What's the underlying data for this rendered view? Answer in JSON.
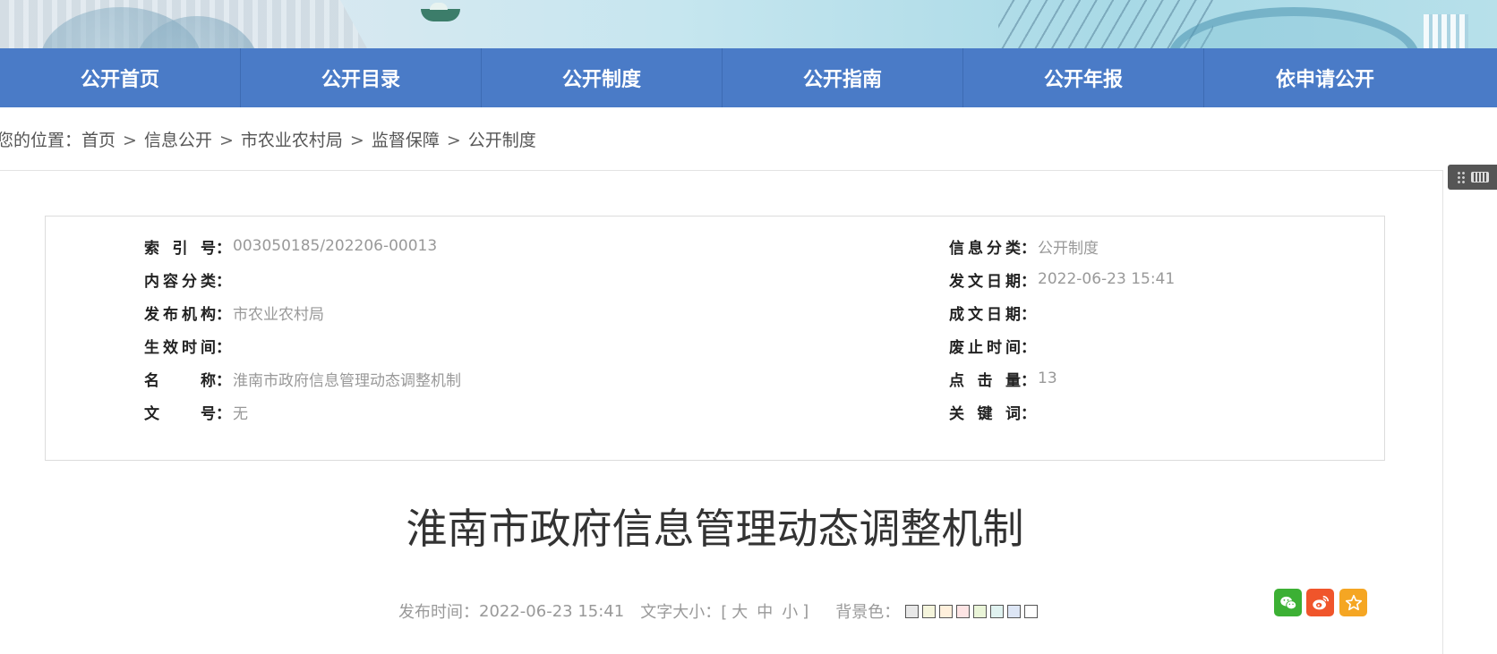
{
  "nav": {
    "items": [
      {
        "label": "公开首页"
      },
      {
        "label": "公开目录"
      },
      {
        "label": "公开制度"
      },
      {
        "label": "公开指南"
      },
      {
        "label": "公开年报"
      },
      {
        "label": "依申请公开"
      }
    ]
  },
  "breadcrumb": {
    "prefix": "您的位置：",
    "items": [
      "首页",
      "信息公开",
      "市农业农村局",
      "监督保障",
      "公开制度"
    ],
    "separator": ">"
  },
  "meta": {
    "index_label": "索引号",
    "index_value": "003050185/202206-00013",
    "category_label": "信息分类",
    "category_value": "公开制度",
    "content_class_label": "内容分类",
    "content_class_value": "",
    "issue_date_label": "发文日期",
    "issue_date_value": "2022-06-23 15:41",
    "publisher_label": "发布机构",
    "publisher_value": "市农业农村局",
    "written_date_label": "成文日期",
    "written_date_value": "",
    "effective_label": "生效时间",
    "effective_value": "",
    "abolish_label": "废止时间",
    "abolish_value": "",
    "name_label": "名称",
    "name_value": "淮南市政府信息管理动态调整机制",
    "clicks_label": "点击量",
    "clicks_value": "13",
    "doc_no_label": "文号",
    "doc_no_value": "无",
    "keywords_label": "关键词",
    "keywords_value": "",
    "colon": "："
  },
  "article": {
    "title": "淮南市政府信息管理动态调整机制"
  },
  "info_bar": {
    "publish_label": "发布时间：",
    "publish_time": "2022-06-23 15:41",
    "font_size_label": "文字大小：[",
    "size_large": "大",
    "size_medium": "中",
    "size_small": "小",
    "bracket_close": "]",
    "bg_label": "背景色："
  },
  "colors": {
    "nav_bg": "#4a7bc7",
    "swatches": [
      "#e8e8e8",
      "#f5f5dc",
      "#fff0dc",
      "#fde4e4",
      "#eaf5d8",
      "#e0f2f0",
      "#dde6f5",
      "#ffffff"
    ],
    "wechat": "#3cb034",
    "weibo": "#f0552b",
    "favorite": "#f5a623"
  },
  "share": {
    "icons": [
      "wechat-icon",
      "weibo-icon",
      "favorite-star-icon"
    ]
  }
}
